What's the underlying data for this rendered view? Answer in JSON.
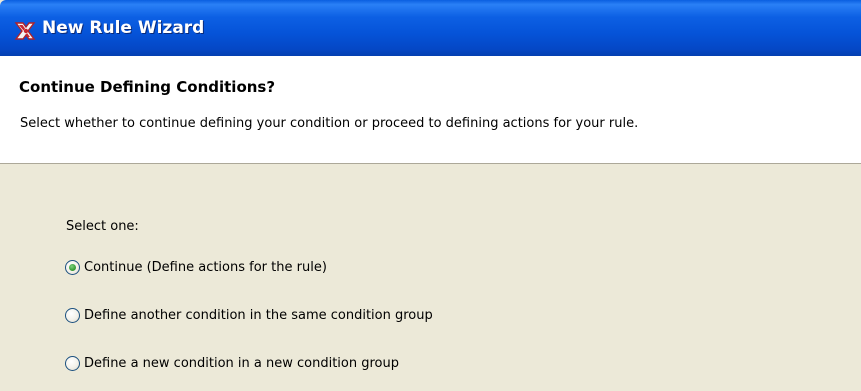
{
  "window": {
    "title": "New Rule Wizard",
    "icon": "rule-wizard-icon"
  },
  "header": {
    "title": "Continue Defining Conditions?",
    "description": "Select whether to continue defining your condition or proceed to defining actions for your rule."
  },
  "body": {
    "group_label": "Select one:",
    "options": [
      {
        "label": "Continue (Define actions for the rule)",
        "checked": true
      },
      {
        "label": "Define another condition in the same condition group",
        "checked": false
      },
      {
        "label": "Define a new condition in a new condition group",
        "checked": false
      }
    ]
  },
  "colors": {
    "titlebar": "#0553d8",
    "dialog_background": "#ece9d8",
    "header_background": "#ffffff",
    "radio_selected": "#3fa43f"
  }
}
